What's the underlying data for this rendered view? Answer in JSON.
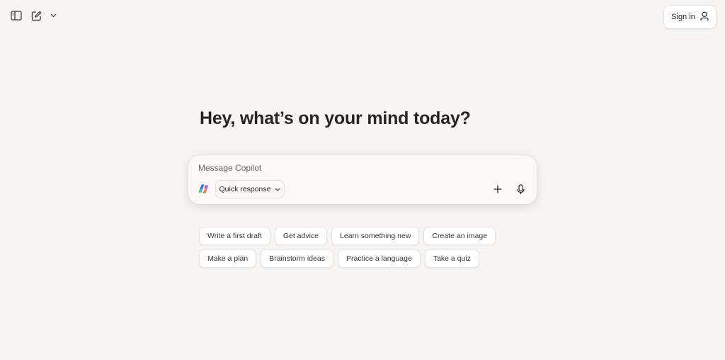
{
  "header": {
    "sidebar_icon": "sidebar-toggle-icon",
    "new_chat_icon": "compose-icon",
    "chevron_icon": "chevron-down-icon",
    "sign_in_label": "Sign in",
    "sign_in_icon": "user-icon"
  },
  "main": {
    "headline": "Hey, what’s on your mind today?"
  },
  "composer": {
    "placeholder": "Message Copilot",
    "value": "",
    "mode_label": "Quick response",
    "logo_icon": "copilot-logo-icon",
    "add_icon": "plus-icon",
    "mic_icon": "microphone-icon"
  },
  "suggestions": {
    "row1": [
      "Write a first draft",
      "Get advice",
      "Learn something new",
      "Create an image"
    ],
    "row2": [
      "Make a plan",
      "Brainstorm ideas",
      "Practice a language",
      "Take a quiz"
    ]
  },
  "colors": {
    "background": "#f7f4f1",
    "card": "#ffffff",
    "text": "#2a2420"
  }
}
